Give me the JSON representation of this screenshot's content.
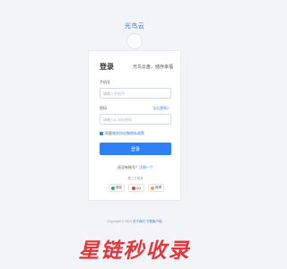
{
  "brand": {
    "name": "光鸟云"
  },
  "login": {
    "title": "登录",
    "slogan": "光鸟云盘，储存幸福",
    "phone_label": "手机号",
    "phone_placeholder": "请输入手机号",
    "password_label": "密码",
    "password_placeholder": "请输入6-20位密码",
    "forgot_label": "忘记密码?",
    "agree_prefix": "同意",
    "agree_terms": "服务协议",
    "agree_and": "和",
    "agree_privacy": "隐私政策",
    "submit_label": "登录",
    "register_prompt": "还没有账号？",
    "register_link": "注册一个",
    "divider_text": "第三方登录",
    "socials": [
      {
        "label": "微信",
        "color": "#2bb24c"
      },
      {
        "label": "QQ",
        "color": "#e5433e"
      },
      {
        "label": "微博",
        "color": "#f0a020"
      }
    ]
  },
  "footer": {
    "copyright": "Copyright © 2024",
    "about_link": "关于我们",
    "download_link": "下载客户端"
  },
  "watermark": "星链秒收录",
  "colors": {
    "accent": "#2f7ff5",
    "watermark": "#e2373a"
  }
}
